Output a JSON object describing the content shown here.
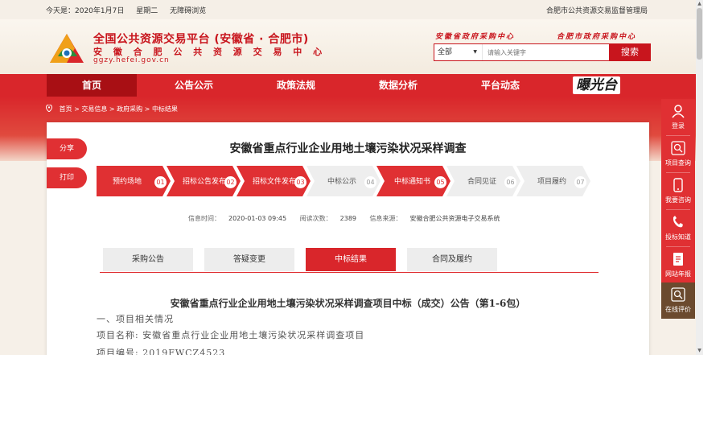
{
  "topbar": {
    "date_label": "今天是：2020年1月7日",
    "weekday": "星期二",
    "accessibility": "无障碍浏览",
    "agency": "合肥市公共资源交易监督管理局"
  },
  "header": {
    "title": "全国公共资源交易平台 (安徽省 · 合肥市)",
    "subtitle": "安 徽 合 肥 公 共 资 源 交 易 中 心",
    "url": "ggzy.hefei.gov.cn",
    "link_left": "安徽省政府采购中心",
    "link_right": "合肥市政府采购中心"
  },
  "search": {
    "select_value": "全部",
    "placeholder": "请输入关键字",
    "button": "搜索"
  },
  "nav": {
    "items": [
      "首页",
      "公告公示",
      "政策法规",
      "数据分析",
      "平台动态"
    ],
    "brand": "曝光台"
  },
  "breadcrumb": [
    "首页",
    "交易信息",
    "政府采购",
    "中标结果"
  ],
  "side_buttons": {
    "share": "分享",
    "print": "打印"
  },
  "page_title": "安徽省重点行业企业用地土壤污染状况采样调查",
  "steps": [
    {
      "label": "预约场地",
      "num": "01",
      "active": true
    },
    {
      "label": "招标公告发布",
      "num": "02",
      "active": true
    },
    {
      "label": "招标文件发布",
      "num": "03",
      "active": true
    },
    {
      "label": "中标公示",
      "num": "04",
      "active": false
    },
    {
      "label": "中标通知书",
      "num": "05",
      "active": true
    },
    {
      "label": "合同见证",
      "num": "06",
      "active": false
    },
    {
      "label": "项目履约",
      "num": "07",
      "active": false
    }
  ],
  "meta": {
    "time_label": "信息时间：",
    "time_value": "2020-01-03 09:45",
    "views_label": "阅读次数：",
    "views_value": "2389",
    "source_label": "信息来源：",
    "source_value": "安徽合肥公共资源电子交易系统"
  },
  "tabs": [
    "采购公告",
    "答疑变更",
    "中标结果",
    "合同及履约"
  ],
  "document": {
    "title": "安徽省重点行业企业用地土壤污染状况采样调查项目中标（成交）公告（第1-6包）",
    "section": "一、项目相关情况",
    "name_line": "项目名称: 安徽省重点行业企业用地土壤污染状况采样调查项目",
    "code_line": "项目编号: 2019FWCZ4523"
  },
  "rightbar": [
    "登录",
    "项目查询",
    "我要咨询",
    "投标知道",
    "网站年报",
    "在线评价"
  ],
  "colors": {
    "brand_red": "#d9262b",
    "dark_red": "#a80f14",
    "sidebar_selected": "#6b4a2e"
  }
}
